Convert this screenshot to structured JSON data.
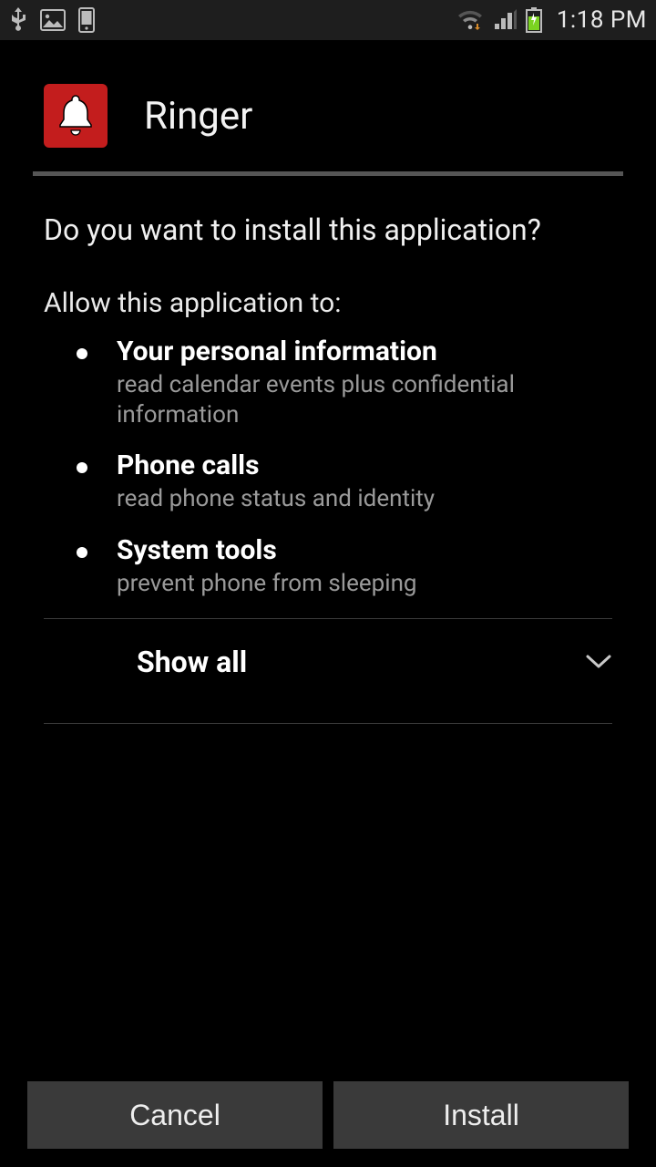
{
  "status": {
    "time": "1:18 PM"
  },
  "app": {
    "name": "Ringer"
  },
  "prompt": {
    "question": "Do you want to install this application?",
    "allow_heading": "Allow this application to:",
    "permissions": [
      {
        "title": "Your personal information",
        "detail": "read calendar events plus confidential information"
      },
      {
        "title": "Phone calls",
        "detail": "read phone status and identity"
      },
      {
        "title": "System tools",
        "detail": "prevent phone from sleeping"
      }
    ],
    "show_all": "Show all"
  },
  "buttons": {
    "cancel": "Cancel",
    "install": "Install"
  },
  "colors": {
    "app_icon_bg": "#c31d1d"
  }
}
